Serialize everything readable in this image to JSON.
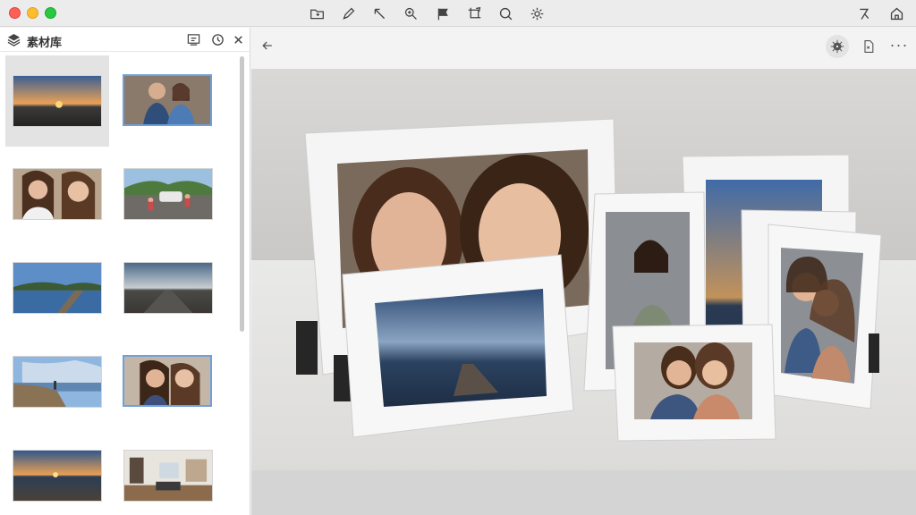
{
  "window": {
    "toolbar_tools": [
      "folder-icon",
      "pen-icon",
      "arrow-pointer-icon",
      "zoom-icon",
      "flag-icon",
      "crop-icon",
      "search-icon",
      "gear-icon"
    ],
    "right_tools": [
      "magic-icon",
      "home-icon"
    ]
  },
  "sidebar": {
    "title": "素材库",
    "header_buttons": [
      "slideshow-icon",
      "history-icon",
      "close-icon"
    ],
    "thumbnails": [
      {
        "subject": "sunset-beach",
        "selected_bg": true,
        "border_selected": false
      },
      {
        "subject": "couple-portrait",
        "selected_bg": false,
        "border_selected": true
      },
      {
        "subject": "two-women-selfie",
        "selected_bg": false,
        "border_selected": false
      },
      {
        "subject": "road-trip-car",
        "selected_bg": false,
        "border_selected": false
      },
      {
        "subject": "lake-reflection",
        "selected_bg": false,
        "border_selected": false
      },
      {
        "subject": "open-road",
        "selected_bg": false,
        "border_selected": false
      },
      {
        "subject": "coastal-walk",
        "selected_bg": false,
        "border_selected": false
      },
      {
        "subject": "friends-selfie",
        "selected_bg": false,
        "border_selected": true
      },
      {
        "subject": "ocean-sunset",
        "selected_bg": false,
        "border_selected": false
      },
      {
        "subject": "living-room",
        "selected_bg": false,
        "border_selected": false
      }
    ]
  },
  "main": {
    "toolbar_buttons": [
      "back-arrow-icon",
      "settings-gear-icon",
      "export-icon",
      "more-icon"
    ],
    "more_label": "···"
  },
  "colors": {
    "accent": "#6fa0de",
    "selection": "#e3e3e3",
    "traffic_red": "#fe5f57",
    "traffic_yellow": "#febc2e",
    "traffic_green": "#28c840"
  }
}
